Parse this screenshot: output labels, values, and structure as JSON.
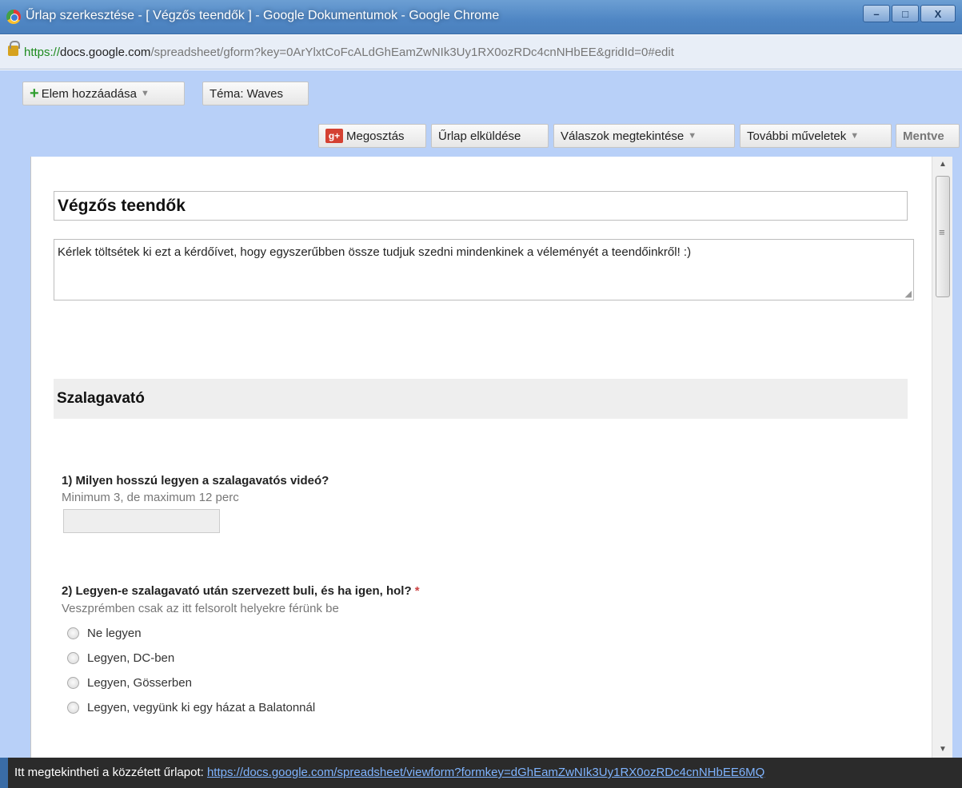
{
  "window": {
    "title": "Űrlap szerkesztése - [ Végzős teendők ] - Google Dokumentumok - Google Chrome",
    "controls": {
      "minimize": "–",
      "maximize": "□",
      "close": "X"
    }
  },
  "address": {
    "scheme": "https://",
    "host": "docs.google.com",
    "path": "/spreadsheet/gform?key=0ArYlxtCoFcALdGhEamZwNIk3Uy1RX0ozRDc4cnNHbEE&gridId=0#edit"
  },
  "toolbar": {
    "add_item": "Elem hozzáadása",
    "theme": "Téma:  Waves",
    "share": "Megosztás",
    "send_form": "Űrlap elküldése",
    "view_responses": "Válaszok megtekintése",
    "more_actions": "További műveletek",
    "save": "Mentve",
    "gplus_badge": "g+"
  },
  "form": {
    "title": "Végzős teendők",
    "description": "Kérlek töltsétek ki ezt a kérdőívet, hogy egyszerűbben össze tudjuk szedni mindenkinek a véleményét a teendőinkről! :)",
    "section_title": "Szalagavató",
    "questions": [
      {
        "title": "1) Milyen hosszú legyen a szalagavatós videó?",
        "help": "Minimum 3, de maximum 12 perc",
        "required": false
      },
      {
        "title": "2) Legyen-e szalagavató után szervezett buli, és ha igen, hol?",
        "help": "Veszprémben csak az itt felsorolt helyekre férünk be",
        "required": true,
        "required_mark": "*",
        "options": [
          "Ne legyen",
          "Legyen, DC-ben",
          "Legyen, Gösserben",
          "Legyen, vegyünk ki egy házat a Balatonnál"
        ]
      }
    ]
  },
  "footer": {
    "label": "Itt megtekintheti a közzétett űrlapot:",
    "link": "https://docs.google.com/spreadsheet/viewform?formkey=dGhEamZwNIk3Uy1RX0ozRDc4cnNHbEE6MQ"
  }
}
